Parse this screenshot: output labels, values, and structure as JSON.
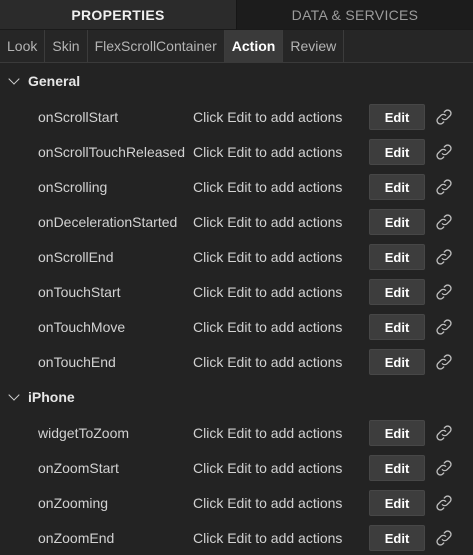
{
  "top_tabs": [
    {
      "label": "PROPERTIES",
      "active": true
    },
    {
      "label": "DATA & SERVICES",
      "active": false
    }
  ],
  "sub_tabs": [
    {
      "label": "Look",
      "active": false
    },
    {
      "label": "Skin",
      "active": false
    },
    {
      "label": "FlexScrollContainer",
      "active": false
    },
    {
      "label": "Action",
      "active": true
    },
    {
      "label": "Review",
      "active": false
    }
  ],
  "sections": [
    {
      "title": "General",
      "rows": [
        {
          "name": "onScrollStart",
          "placeholder": "Click Edit to add actions",
          "button": "Edit"
        },
        {
          "name": "onScrollTouchReleased",
          "placeholder": "Click Edit to add actions",
          "button": "Edit"
        },
        {
          "name": "onScrolling",
          "placeholder": "Click Edit to add actions",
          "button": "Edit"
        },
        {
          "name": "onDecelerationStarted",
          "placeholder": "Click Edit to add actions",
          "button": "Edit"
        },
        {
          "name": "onScrollEnd",
          "placeholder": "Click Edit to add actions",
          "button": "Edit"
        },
        {
          "name": "onTouchStart",
          "placeholder": "Click Edit to add actions",
          "button": "Edit"
        },
        {
          "name": "onTouchMove",
          "placeholder": "Click Edit to add actions",
          "button": "Edit"
        },
        {
          "name": "onTouchEnd",
          "placeholder": "Click Edit to add actions",
          "button": "Edit"
        }
      ]
    },
    {
      "title": "iPhone",
      "rows": [
        {
          "name": "widgetToZoom",
          "placeholder": "Click Edit to add actions",
          "button": "Edit"
        },
        {
          "name": "onZoomStart",
          "placeholder": "Click Edit to add actions",
          "button": "Edit"
        },
        {
          "name": "onZooming",
          "placeholder": "Click Edit to add actions",
          "button": "Edit"
        },
        {
          "name": "onZoomEnd",
          "placeholder": "Click Edit to add actions",
          "button": "Edit"
        }
      ]
    }
  ],
  "icons": {
    "section_toggle": "chevron-down-icon",
    "row_link": "link-icon"
  },
  "colors": {
    "background": "#232323",
    "active_tab": "#2b2b2b",
    "button": "#3d3d3d"
  }
}
